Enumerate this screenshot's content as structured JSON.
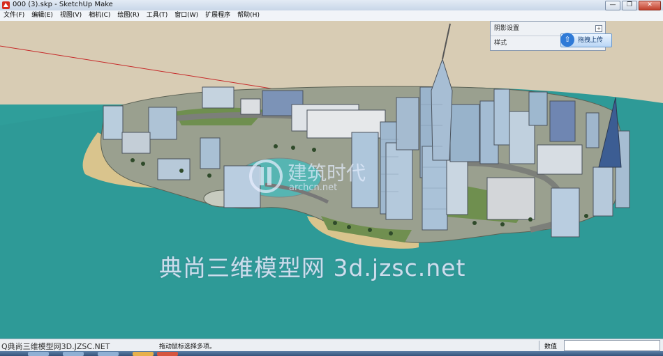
{
  "window": {
    "title": "000 (3).skp - SketchUp Make",
    "minimize_glyph": "—",
    "restore_glyph": "❐",
    "close_glyph": "✕"
  },
  "menubar": {
    "items": [
      {
        "label": "文件(F)"
      },
      {
        "label": "编辑(E)"
      },
      {
        "label": "视图(V)"
      },
      {
        "label": "相机(C)"
      },
      {
        "label": "绘图(R)"
      },
      {
        "label": "工具(T)"
      },
      {
        "label": "窗口(W)"
      },
      {
        "label": "扩展程序"
      },
      {
        "label": "帮助(H)"
      }
    ]
  },
  "tray_panel": {
    "shadow_settings": "阴影设置",
    "styles": "样式",
    "expand_glyph": "+"
  },
  "upload_button": {
    "label": "拖拽上传",
    "icon": "cloud-upload-icon"
  },
  "viewport": {
    "watermark": "典尚三维模型网 3d.jzsc.net",
    "logo_text": "建筑时代",
    "logo_url": "archcn.net"
  },
  "statusbar": {
    "overlap_text": "Q典尚三维模型网3D.JZSC.NET",
    "hint": "拖动鼠标选择多项。",
    "measurements_label": "数值",
    "measurements_value": ""
  },
  "colors": {
    "sky": "#d8ccb4",
    "ground": "#2f9e9a",
    "sand": "#d9c48d",
    "island": "#9aa08f",
    "accent": "#2f7ad7"
  }
}
